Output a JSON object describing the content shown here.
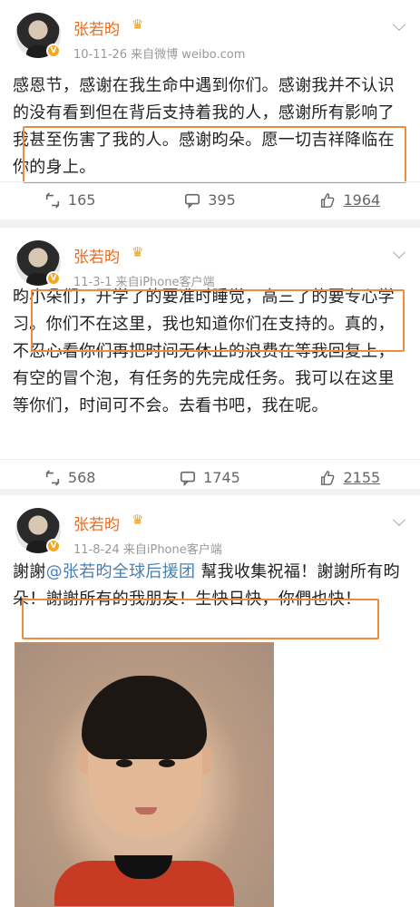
{
  "posts": [
    {
      "author": "张若昀",
      "meta": "10-11-26  来自微博 weibo.com",
      "text": "感恩节，感谢在我生命中遇到你们。感谢我并不认识的没有看到但在背后支持着我的人，感谢所有影响了我甚至伤害了我的人。感谢昀朵。愿一切吉祥降临在你的身上。",
      "repost": "165",
      "comment": "395",
      "like": "1964"
    },
    {
      "author": "张若昀",
      "meta": "11-3-1  来自iPhone客户端",
      "text": "昀小朵们，开学了的要准时睡觉，高三了的要专心学习。你们不在这里，我也知道你们在支持的。真的，不忍心看你们再把时间无休止的浪费在等我回复上，有空的冒个泡，有任务的先完成任务。我可以在这里等你们，时间可不会。去看书吧，我在呢。",
      "repost": "568",
      "comment": "1745",
      "like": "2155"
    },
    {
      "author": "张若昀",
      "meta": "11-8-24  来自iPhone客户端",
      "text_before": "謝謝",
      "mention": "@张若昀全球后援团",
      "text_after": " 幫我收集祝福！謝謝所有昀朵！謝謝所有的我朋友！生快日快，你們也快！"
    }
  ],
  "icons": {
    "repost": "repost-icon",
    "comment": "comment-icon",
    "like": "like-icon",
    "crown": "crown-icon",
    "verified": "verified-badge-icon",
    "chevron": "chevron-down-icon"
  },
  "colors": {
    "name": "#e86b1f",
    "highlight": "#f08a3c",
    "link": "#4a7fb0"
  }
}
